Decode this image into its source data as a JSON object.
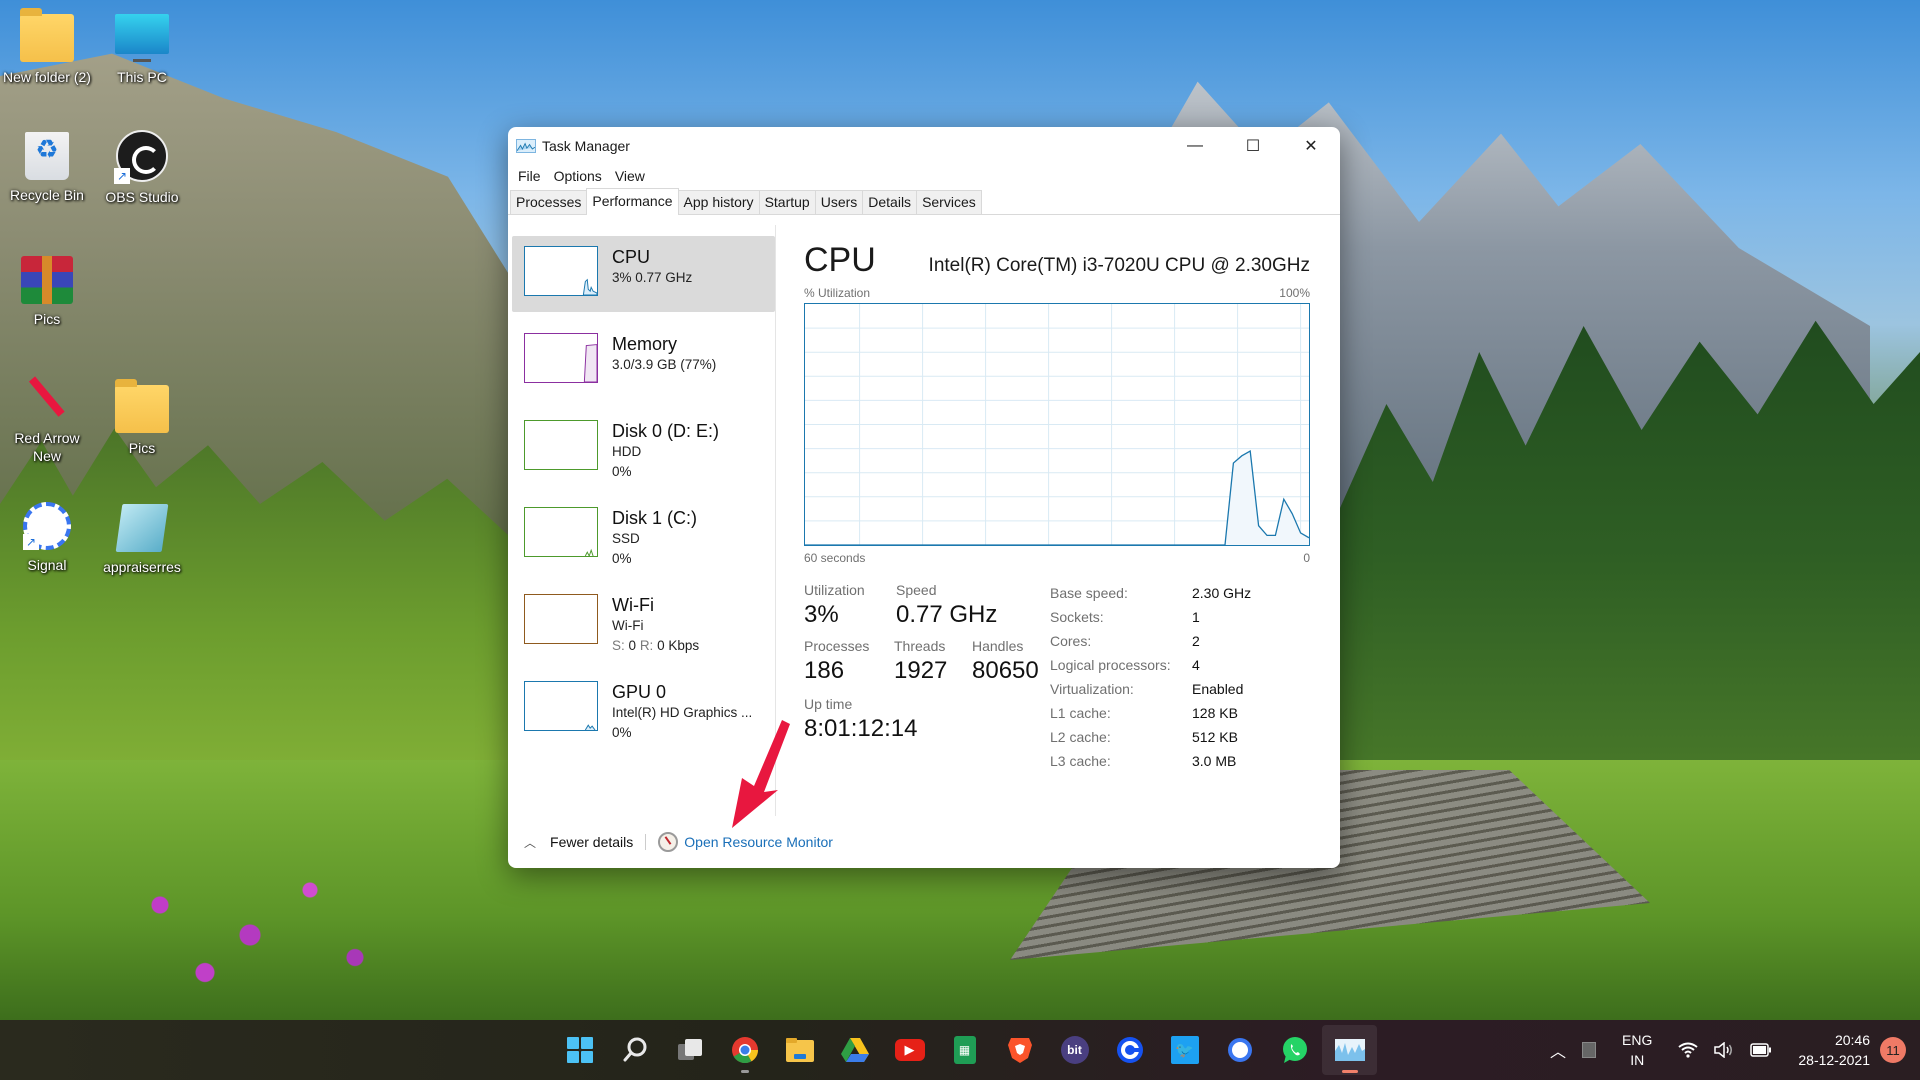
{
  "desktop": {
    "icons": [
      {
        "label": "New folder (2)",
        "icon": "folder-icon"
      },
      {
        "label": "This PC",
        "icon": "monitor-icon"
      },
      {
        "label": "Recycle Bin",
        "icon": "recycle-bin-icon"
      },
      {
        "label": "OBS Studio",
        "icon": "obs-icon"
      },
      {
        "label": "Pics",
        "icon": "winrar-archive-icon"
      },
      {
        "label": "Red Arrow New",
        "icon": "red-arrow-image-icon"
      },
      {
        "label": "Pics",
        "icon": "folder-icon"
      },
      {
        "label": "Signal",
        "icon": "signal-icon"
      },
      {
        "label": "appraiserres",
        "icon": "notepad-icon"
      }
    ]
  },
  "window": {
    "title": "Task Manager",
    "controls": {
      "minimize": "—",
      "maximize": "☐",
      "close": "✕"
    },
    "menu": [
      "File",
      "Options",
      "View"
    ],
    "tabs": [
      "Processes",
      "Performance",
      "App history",
      "Startup",
      "Users",
      "Details",
      "Services"
    ],
    "active_tab": "Performance",
    "sidebar": [
      {
        "title": "CPU",
        "lines": [
          "3% 0.77 GHz"
        ],
        "color": "#1b78ae",
        "active": true
      },
      {
        "title": "Memory",
        "lines": [
          "3.0/3.9 GB (77%)"
        ],
        "color": "#8b2fa0"
      },
      {
        "title": "Disk 0 (D: E:)",
        "lines": [
          "HDD",
          "0%"
        ],
        "color": "#4d9a2c"
      },
      {
        "title": "Disk 1 (C:)",
        "lines": [
          "SSD",
          "0%"
        ],
        "color": "#4d9a2c"
      },
      {
        "title": "Wi-Fi",
        "lines": [
          "Wi-Fi"
        ],
        "wifi_rate": {
          "s_label": "S:",
          "s_value": "0",
          "r_label": "R:",
          "r_value": "0 Kbps"
        },
        "color": "#8f5a1e"
      },
      {
        "title": "GPU 0",
        "lines": [
          "Intel(R) HD Graphics ...",
          "0%"
        ],
        "color": "#1b78ae"
      }
    ],
    "cpu": {
      "title": "CPU",
      "model": "Intel(R) Core(TM) i3-7020U CPU @ 2.30GHz",
      "chart_label_left": "% Utilization",
      "chart_label_right": "100%",
      "chart_time_left": "60 seconds",
      "chart_time_right": "0",
      "stats": {
        "utilization_label": "Utilization",
        "utilization": "3%",
        "speed_label": "Speed",
        "speed": "0.77 GHz",
        "processes_label": "Processes",
        "processes": "186",
        "threads_label": "Threads",
        "threads": "1927",
        "handles_label": "Handles",
        "handles": "80650",
        "uptime_label": "Up time",
        "uptime": "8:01:12:14"
      },
      "specs": [
        {
          "label": "Base speed:",
          "value": "2.30 GHz"
        },
        {
          "label": "Sockets:",
          "value": "1"
        },
        {
          "label": "Cores:",
          "value": "2"
        },
        {
          "label": "Logical processors:",
          "value": "4"
        },
        {
          "label": "Virtualization:",
          "value": "Enabled"
        },
        {
          "label": "L1 cache:",
          "value": "128 KB"
        },
        {
          "label": "L2 cache:",
          "value": "512 KB"
        },
        {
          "label": "L3 cache:",
          "value": "3.0 MB"
        }
      ]
    },
    "footer": {
      "fewer_details": "Fewer details",
      "open_resource_monitor": "Open Resource Monitor"
    }
  },
  "chart_data": {
    "type": "area",
    "title": "% Utilization",
    "xlabel": "60 seconds",
    "ylabel": "% Utilization",
    "x_range": [
      60,
      0
    ],
    "ylim": [
      0,
      100
    ],
    "grid": true,
    "series": [
      {
        "name": "CPU",
        "color": "#1b78ae",
        "x_seconds_ago": [
          60,
          10,
          9,
          8,
          7,
          6,
          5,
          4,
          3,
          2,
          1,
          0
        ],
        "values": [
          0,
          0,
          34,
          37,
          39,
          8,
          4,
          4,
          19,
          13,
          5,
          3
        ]
      }
    ]
  },
  "taskbar": {
    "apps": [
      {
        "name": "start-button",
        "icon": "windows-logo-icon"
      },
      {
        "name": "search",
        "icon": "search-icon"
      },
      {
        "name": "task-view",
        "icon": "task-view-icon"
      },
      {
        "name": "chrome",
        "icon": "chrome-icon",
        "running": true
      },
      {
        "name": "file-explorer",
        "icon": "folder-icon"
      },
      {
        "name": "google-drive",
        "icon": "google-drive-icon"
      },
      {
        "name": "youtube",
        "icon": "youtube-icon"
      },
      {
        "name": "google-sheets",
        "icon": "sheets-icon"
      },
      {
        "name": "brave",
        "icon": "brave-icon"
      },
      {
        "name": "bit",
        "icon": "bit-icon",
        "label": "bit"
      },
      {
        "name": "coinbase",
        "icon": "coinbase-icon"
      },
      {
        "name": "twitter",
        "icon": "twitter-icon"
      },
      {
        "name": "signal",
        "icon": "signal-icon"
      },
      {
        "name": "whatsapp",
        "icon": "whatsapp-icon"
      },
      {
        "name": "task-manager",
        "icon": "task-manager-icon",
        "active": true
      }
    ],
    "tray": {
      "language": "ENG",
      "region": "IN",
      "time": "20:46",
      "date": "28-12-2021",
      "notifications": "11"
    }
  }
}
